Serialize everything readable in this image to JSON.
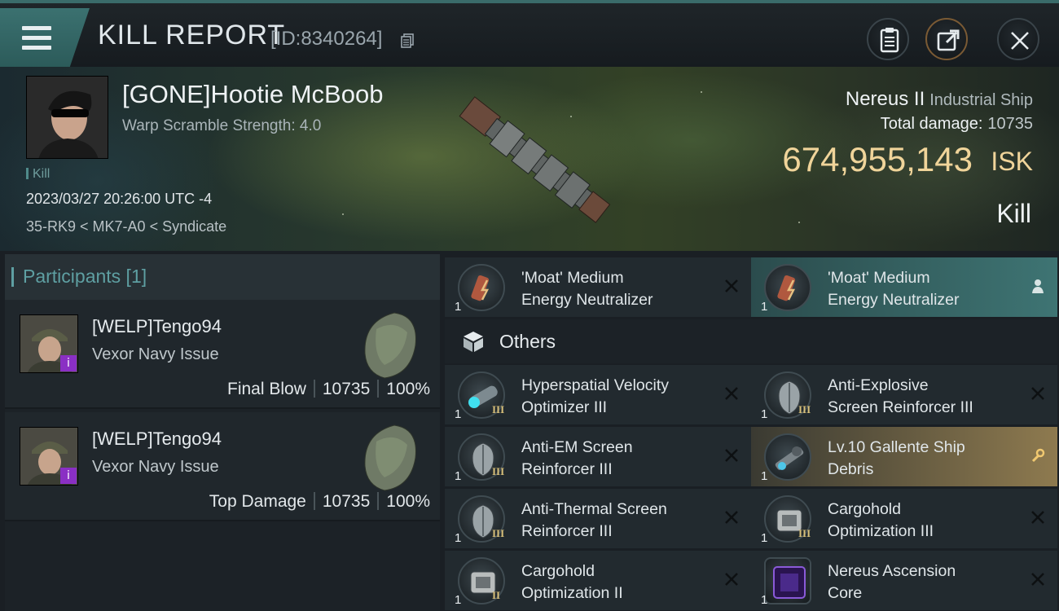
{
  "header": {
    "title": "KILL REPORT",
    "kill_id": "[ID:8340264]"
  },
  "victim": {
    "name": "[GONE]Hootie McBoob",
    "warp_scramble": "Warp Scramble Strength: 4.0",
    "kill_tag": "Kill",
    "timestamp": "2023/03/27 20:26:00 UTC -4",
    "location": "35-RK9 < MK7-A0 < Syndicate"
  },
  "ship": {
    "name": "Nereus II",
    "class": "Industrial Ship",
    "total_damage_label": "Total damage:",
    "total_damage": "10735",
    "isk_value": "674,955,143",
    "isk_unit": "ISK",
    "status": "Kill"
  },
  "participants": {
    "title": "Participants [1]",
    "items": [
      {
        "name": "[WELP]Tengo94",
        "ship": "Vexor Navy Issue",
        "role": "Final Blow",
        "damage": "10735",
        "percent": "100%"
      },
      {
        "name": "[WELP]Tengo94",
        "ship": "Vexor Navy Issue",
        "role": "Top Damage",
        "damage": "10735",
        "percent": "100%"
      }
    ]
  },
  "others_label": "Others",
  "items": [
    {
      "qty": "1",
      "tier": "",
      "line1": "'Moat' Medium",
      "line2": "Energy Neutralizer",
      "status": "destroyed",
      "icon": "energy-neutralizer-icon"
    },
    {
      "qty": "1",
      "tier": "",
      "line1": "'Moat' Medium",
      "line2": "Energy Neutralizer",
      "status": "dropped",
      "icon": "energy-neutralizer-icon"
    },
    {
      "qty": "1",
      "tier": "III",
      "line1": "Hyperspatial Velocity",
      "line2": "Optimizer III",
      "status": "destroyed",
      "icon": "velocity-optimizer-icon"
    },
    {
      "qty": "1",
      "tier": "III",
      "line1": "Anti-Explosive",
      "line2": "Screen Reinforcer III",
      "status": "destroyed",
      "icon": "shield-rig-icon"
    },
    {
      "qty": "1",
      "tier": "III",
      "line1": "Anti-EM Screen",
      "line2": "Reinforcer III",
      "status": "destroyed",
      "icon": "shield-rig-icon"
    },
    {
      "qty": "1",
      "tier": "",
      "line1": "Lv.10 Gallente Ship",
      "line2": "Debris",
      "status": "special",
      "icon": "ship-debris-icon"
    },
    {
      "qty": "1",
      "tier": "III",
      "line1": "Anti-Thermal Screen",
      "line2": "Reinforcer III",
      "status": "destroyed",
      "icon": "shield-rig-icon"
    },
    {
      "qty": "1",
      "tier": "III",
      "line1": "Cargohold",
      "line2": "Optimization III",
      "status": "destroyed",
      "icon": "cargohold-rig-icon"
    },
    {
      "qty": "1",
      "tier": "II",
      "line1": "Cargohold",
      "line2": "Optimization II",
      "status": "destroyed",
      "icon": "cargohold-rig-icon"
    },
    {
      "qty": "1",
      "tier": "",
      "line1": "Nereus Ascension",
      "line2": "Core",
      "status": "destroyed",
      "icon": "ascension-core-icon"
    }
  ],
  "colors": {
    "accent": "#3b7170",
    "isk": "#f0d49a",
    "participants_title": "#5e9fa2",
    "dropped_row": "#3e7473",
    "special_row": "#8e7a4f",
    "implant_badge": "#8a2fc4"
  }
}
